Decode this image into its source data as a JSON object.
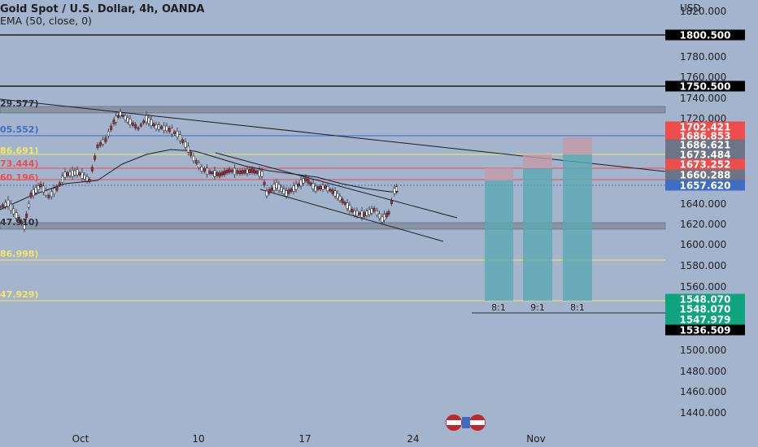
{
  "header": {
    "symbol_line": "Gold Spot / U.S. Dollar, 4h, OANDA",
    "indicator_line": "EMA (50, close, 0)"
  },
  "axis": {
    "currency": "USD",
    "y_ticks": [
      "1820.000",
      "1780.000",
      "1760.000",
      "1740.000",
      "1720.000",
      "1640.000",
      "1620.000",
      "1600.000",
      "1580.000",
      "1560.000",
      "1500.000",
      "1480.000",
      "1460.000",
      "1440.000"
    ],
    "x_ticks": [
      "Oct",
      "10",
      "17",
      "24",
      "Nov"
    ]
  },
  "price_badges": [
    {
      "label": "1800.500",
      "bg": "#000000",
      "fg": "#ffffff"
    },
    {
      "label": "1750.500",
      "bg": "#000000",
      "fg": "#ffffff"
    },
    {
      "label": "1702.421",
      "bg": "#ef4c4c",
      "fg": "#ffffff"
    },
    {
      "label": "1686.853",
      "bg": "#ef4c4c",
      "fg": "#ffffff"
    },
    {
      "label": "1686.621",
      "bg": "#6b7585",
      "fg": "#ffffff"
    },
    {
      "label": "1673.484",
      "bg": "#6b7585",
      "fg": "#ffffff"
    },
    {
      "label": "1673.252",
      "bg": "#ef4c4c",
      "fg": "#ffffff"
    },
    {
      "label": "1660.288",
      "bg": "#6b7585",
      "fg": "#ffffff"
    },
    {
      "label": "1657.620",
      "bg": "#3f6cc4",
      "fg": "#ffffff"
    },
    {
      "label": "1548.070",
      "bg": "#10a37f",
      "fg": "#ffffff"
    },
    {
      "label": "1548.070",
      "bg": "#10a37f",
      "fg": "#ffffff"
    },
    {
      "label": "1547.979",
      "bg": "#10a37f",
      "fg": "#ffffff"
    },
    {
      "label": "1536.509",
      "bg": "#000000",
      "fg": "#ffffff"
    }
  ],
  "fib_labels": [
    {
      "text": "29.577)",
      "color": "#2a2f3a"
    },
    {
      "text": "05.552)",
      "color": "#3f6cc4"
    },
    {
      "text": "86.691)",
      "color": "#f5e663"
    },
    {
      "text": "73.444)",
      "color": "#ef4c4c"
    },
    {
      "text": "60.196)",
      "color": "#ef4c4c"
    },
    {
      "text": "47.910)",
      "color": "#2a2f3a"
    },
    {
      "text": "86.998)",
      "color": "#f5e663"
    },
    {
      "text": "47.929)",
      "color": "#f5e663"
    }
  ],
  "targets": [
    "8:1",
    "9:1",
    "8:1"
  ],
  "colors": {
    "background": "#a3b4cc",
    "up": "#ffffff",
    "down": "#c0262d",
    "ema": "#1c1f26",
    "target_fill": "#5aa9b0",
    "stop_fill": "#c49aa8"
  }
}
